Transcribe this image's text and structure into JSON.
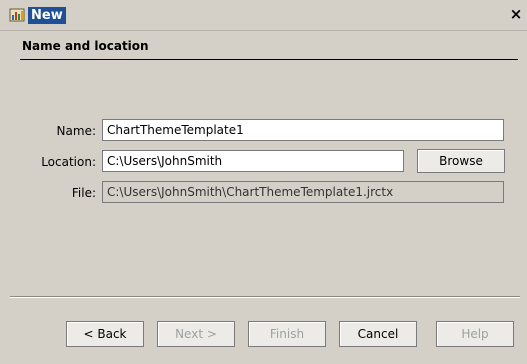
{
  "window": {
    "title": "New",
    "close_glyph": "×",
    "icon": "app-icon"
  },
  "section": {
    "title": "Name and location"
  },
  "form": {
    "name_label": "Name:",
    "name_value": "ChartThemeTemplate1",
    "location_label": "Location:",
    "location_value": "C:\\Users\\JohnSmith",
    "browse_label": "Browse",
    "file_label": "File:",
    "file_value": "C:\\Users\\JohnSmith\\ChartThemeTemplate1.jrctx"
  },
  "buttons": {
    "back": "< Back",
    "next": "Next >",
    "finish": "Finish",
    "cancel": "Cancel",
    "help": "Help"
  }
}
